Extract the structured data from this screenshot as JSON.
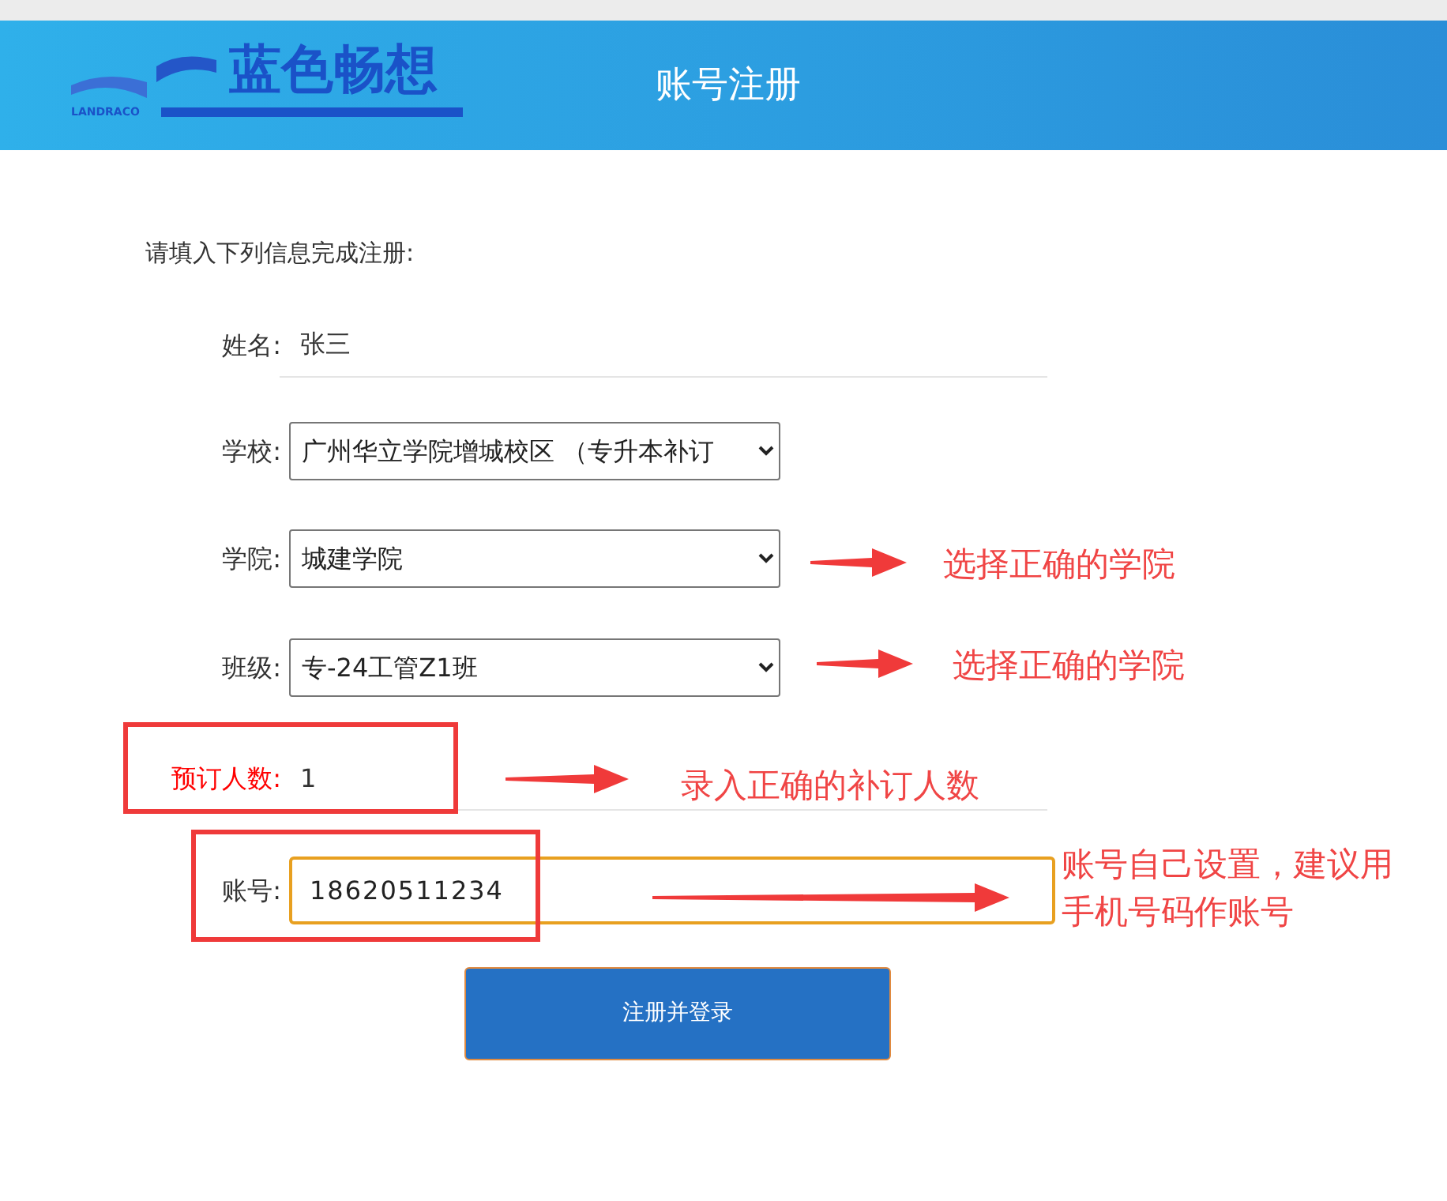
{
  "header": {
    "logo_text": "蓝色畅想",
    "logo_subtext": "LANDRACO",
    "title": "账号注册"
  },
  "form": {
    "intro": "请填入下列信息完成注册:",
    "fields": [
      {
        "kind": "text",
        "label": "姓名:",
        "value": "张三",
        "highlighted": false
      },
      {
        "kind": "select",
        "label": "学校:",
        "value": "广州华立学院增城校区 （专升本补订",
        "highlighted": false
      },
      {
        "kind": "select",
        "label": "学院:",
        "value": "城建学院",
        "highlighted": false
      },
      {
        "kind": "select",
        "label": "班级:",
        "value": "专-24工管Z1班",
        "highlighted": false
      },
      {
        "kind": "text",
        "label": "预订人数:",
        "value": "1",
        "highlighted": true
      },
      {
        "kind": "boxed",
        "label": "账号:",
        "value": "18620511234",
        "highlighted": false
      }
    ],
    "submit": "注册并登录"
  },
  "annotations": [
    {
      "text": "选择正确的学院"
    },
    {
      "text": "选择正确的学院"
    },
    {
      "text": "录入正确的补订人数"
    },
    {
      "text": "账号自己设置，建议用手机号码作账号"
    }
  ]
}
